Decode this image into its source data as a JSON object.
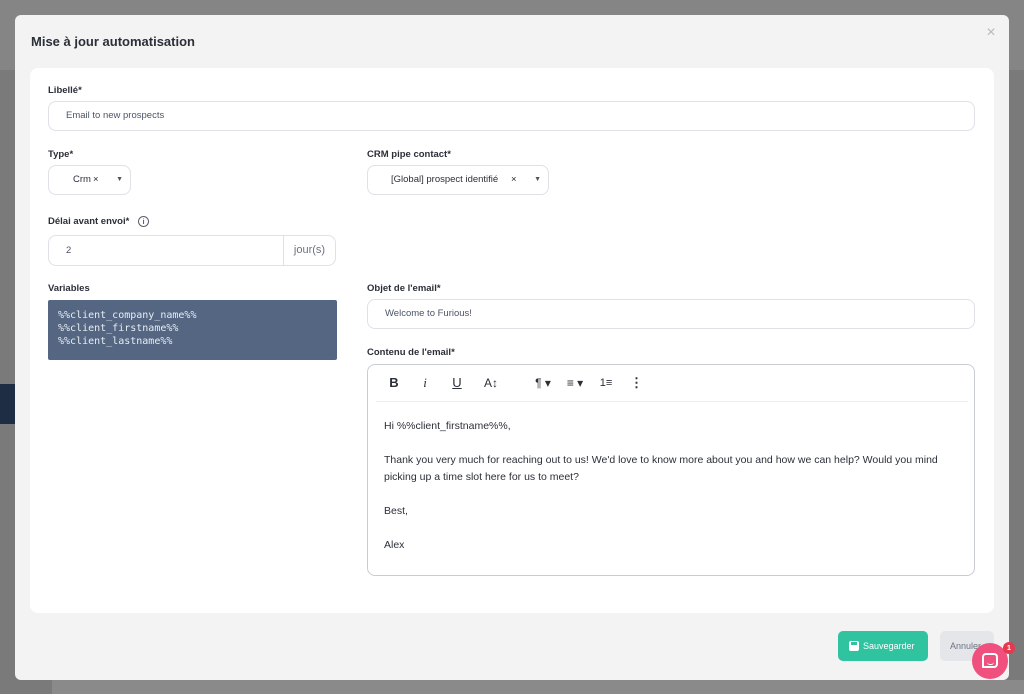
{
  "modal": {
    "title": "Mise à jour automatisation",
    "close_icon": "×"
  },
  "form": {
    "label_field": {
      "label": "Libellé*",
      "value": "Email to new prospects"
    },
    "type_field": {
      "label": "Type*",
      "value": "Crm",
      "clear": "×",
      "arrow": "▼"
    },
    "crm_pipe_field": {
      "label": "CRM pipe contact*",
      "value": "[Global] prospect identifié",
      "clear": "×",
      "arrow": "▼"
    },
    "delay_field": {
      "label": "Délai avant envoi*",
      "info_icon": "i",
      "value": "2",
      "unit": "jour(s)"
    },
    "variables": {
      "label": "Variables",
      "items": [
        "%%client_company_name%%",
        "%%client_firstname%%",
        "%%client_lastname%%"
      ]
    },
    "subject_field": {
      "label": "Objet de l'email*",
      "value": "Welcome to Furious!"
    },
    "content_field": {
      "label": "Contenu de l'email*",
      "toolbar": {
        "bold": "B",
        "italic": "i",
        "underline": "U",
        "font_size": "A↕",
        "paragraph": "¶ ▾",
        "align": "≡ ▾",
        "list": "1≡",
        "more": "⋮"
      },
      "paragraphs": [
        "Hi %%client_firstname%%,",
        "Thank you very much for reaching out to us! We'd love to know more about you and how we can help? Would you mind picking up a time slot here for us to meet?",
        "Best,",
        "Alex"
      ]
    }
  },
  "footer": {
    "save_label": "Sauvegarder",
    "cancel_label": "Annuler"
  },
  "chat": {
    "badge_count": "1"
  },
  "colors": {
    "save": "#2fc3a0",
    "variables_bg": "#546681",
    "chat": "#f0507e"
  }
}
